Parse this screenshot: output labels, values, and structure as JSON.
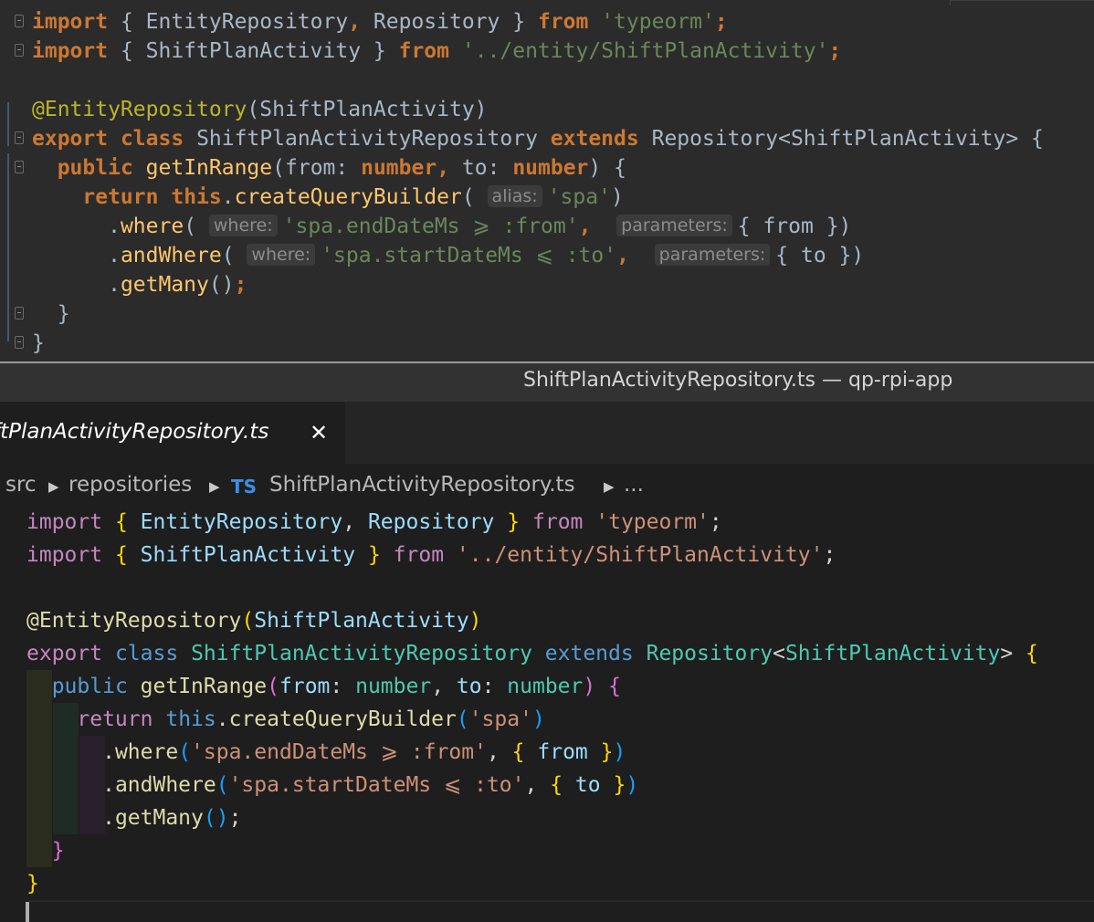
{
  "window": {
    "title": "ShiftPlanActivityRepository.ts — qp-rpi-app"
  },
  "tab": {
    "label": "ftPlanActivityRepository.ts",
    "close_icon": "✕"
  },
  "breadcrumb": {
    "items": [
      "src",
      "repositories",
      "ShiftPlanActivityRepository.ts",
      "..."
    ],
    "file_badge": "TS"
  },
  "top_editor": {
    "hints": {
      "alias": "alias:",
      "where1": "where:",
      "params1": "parameters:",
      "where2": "where:",
      "params2": "parameters:"
    }
  },
  "code": {
    "import_kw": "import",
    "from_kw": "from",
    "export_kw": "export",
    "class_kw": "class",
    "extends_kw": "extends",
    "public_kw": "public",
    "return_kw": "return",
    "this_kw": "this",
    "number_t": "number",
    "entity_repository": "EntityRepository",
    "repository": "Repository",
    "shift_plan_activity": "ShiftPlanActivity",
    "class_name": "ShiftPlanActivityRepository",
    "typeorm_str": "'typeorm'",
    "entity_path_str": "'../entity/ShiftPlanActivity'",
    "decorator": "@EntityRepository",
    "method": "getInRange",
    "param_from": "from",
    "param_to": "to",
    "create_qb": "createQueryBuilder",
    "alias_str": "'spa'",
    "where_fn": "where",
    "and_where_fn": "andWhere",
    "get_many_fn": "getMany",
    "where_str": "'spa.endDateMs ⩾ :from'",
    "and_where_str": "'spa.startDateMs ⩽ :to'"
  },
  "colors": {
    "top_bg": "#2b2b2b",
    "bottom_bg": "#1e1e1e",
    "ts_badge": "#3a8ee6"
  }
}
